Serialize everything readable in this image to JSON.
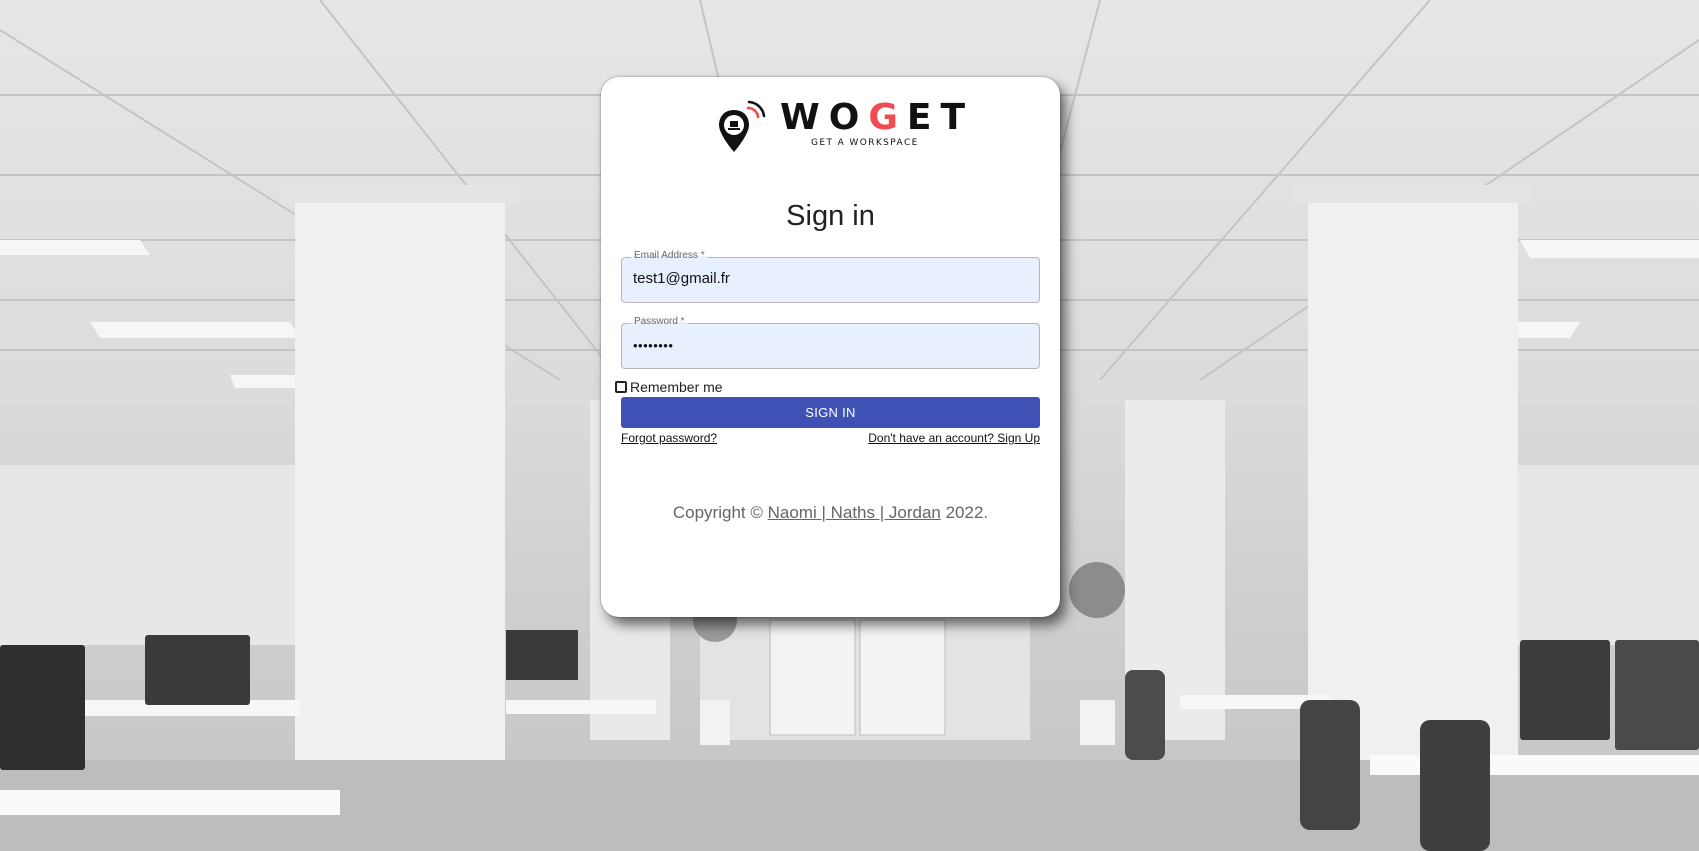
{
  "logo": {
    "word_start": "WO",
    "word_accent": "G",
    "word_end": "ET",
    "tagline": "GET A WORKSPACE",
    "accent_color": "#f24a4f"
  },
  "form": {
    "title": "Sign in",
    "email": {
      "label": "Email Address *",
      "value": "test1@gmail.fr"
    },
    "password": {
      "label": "Password *",
      "value": "••••••••"
    },
    "remember_label": "Remember me",
    "remember_checked": false,
    "submit_label": "SIGN IN",
    "forgot_label": "Forgot password?",
    "signup_label": "Don't have an account? Sign Up",
    "button_color": "#3f51b5"
  },
  "footer": {
    "prefix": "Copyright © ",
    "authors": "Naomi | Naths | Jordan",
    "suffix": " 2022."
  }
}
